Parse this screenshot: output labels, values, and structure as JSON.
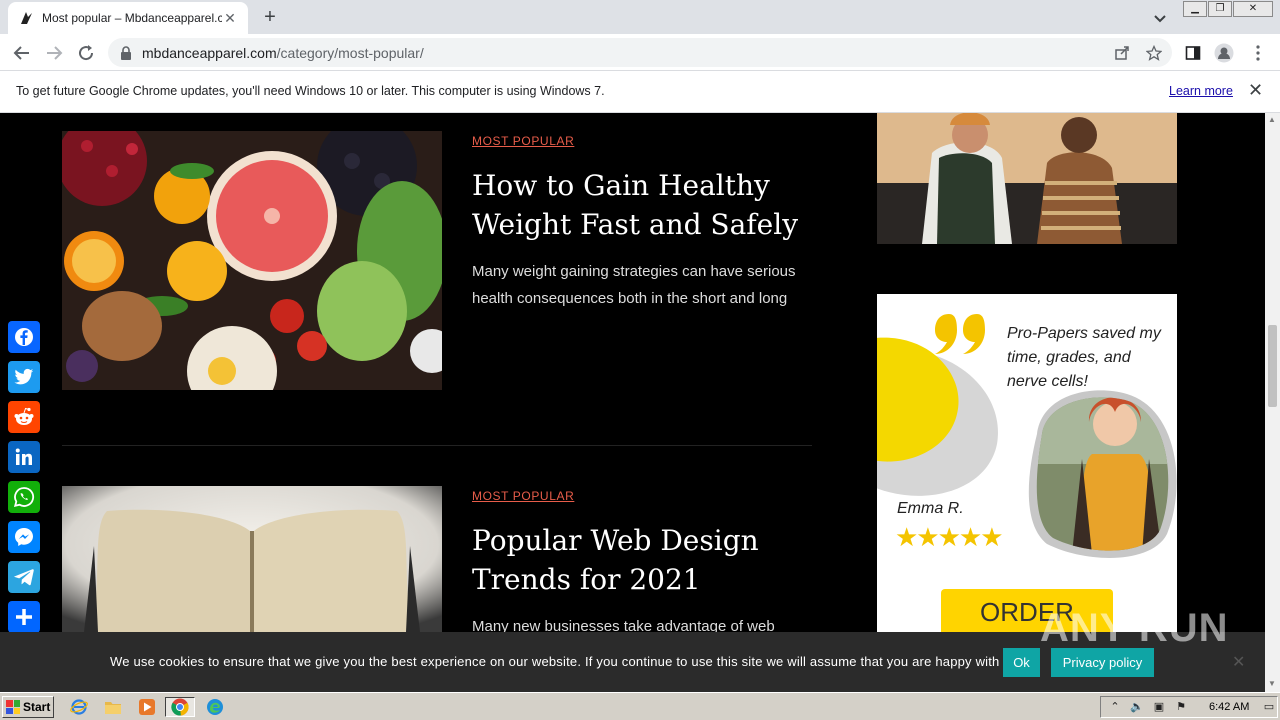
{
  "browser": {
    "tab_title": "Most popular – Mbdanceapparel.com",
    "url_host": "mbdanceapparel.com",
    "url_path": "/category/most-popular/",
    "new_tab_label": "+"
  },
  "infobar": {
    "message": "To get future Google Chrome updates, you'll need Windows 10 or later. This computer is using Windows 7.",
    "learn_more": "Learn more"
  },
  "posts": [
    {
      "category": "MOST POPULAR",
      "title": "How to Gain Healthy Weight Fast and Safely",
      "excerpt": "Many weight gaining strategies can have serious health consequences both in the short and long"
    },
    {
      "category": "MOST POPULAR",
      "title": "Popular Web Design Trends for 2021",
      "excerpt": "Many new businesses take advantage of web"
    }
  ],
  "ad": {
    "quote": "Pro-Papers saved my time, grades, and nerve cells!",
    "name": "Emma R.",
    "stars": "★★★★★",
    "order_label": "ORDER"
  },
  "share": [
    "facebook",
    "twitter",
    "reddit",
    "linkedin",
    "whatsapp",
    "messenger",
    "telegram",
    "share"
  ],
  "cookie": {
    "text": "We use cookies to ensure that we give you the best experience on our website. If you continue to use this site we will assume that you are happy with it.",
    "ok_label": "Ok",
    "privacy_label": "Privacy policy"
  },
  "watermark": "ANY RUN",
  "taskbar": {
    "start_label": "Start",
    "clock": "6:42 AM"
  },
  "colors": {
    "accent": "#e85d4a",
    "cookie_button": "#0fa5a5",
    "ad_yellow": "#ffd400"
  }
}
